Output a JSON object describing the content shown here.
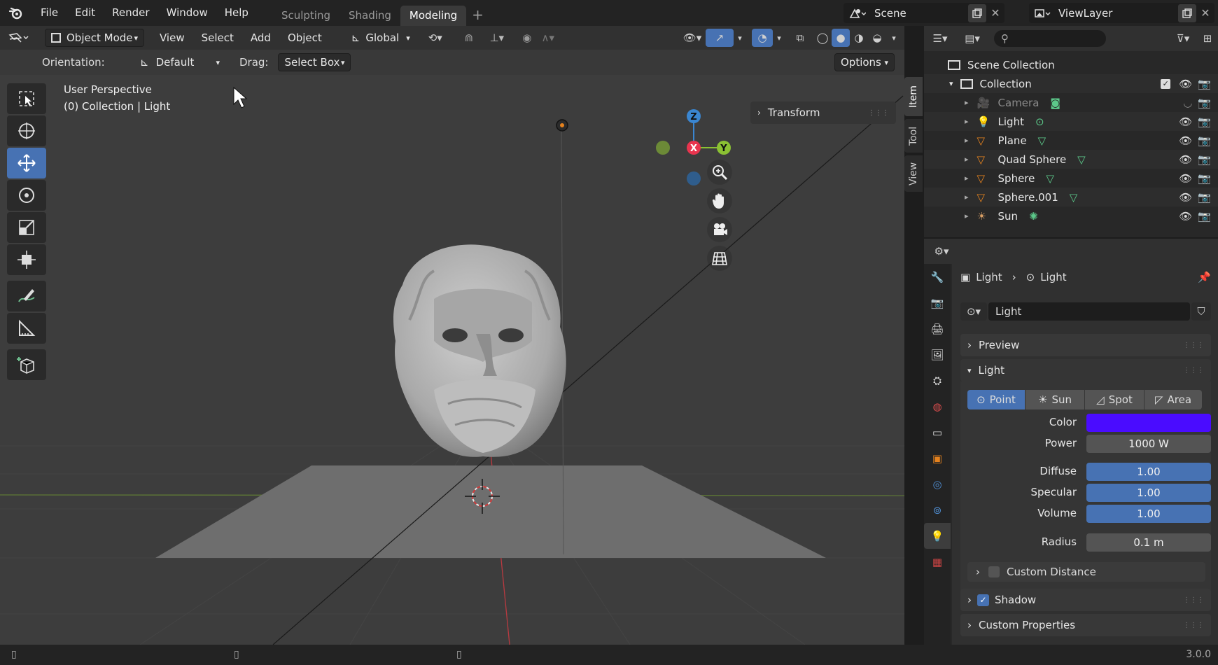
{
  "menu": [
    "File",
    "Edit",
    "Render",
    "Window",
    "Help"
  ],
  "workspaces": [
    {
      "label": "Sculpting",
      "active": false
    },
    {
      "label": "Shading",
      "active": false
    },
    {
      "label": "Modeling",
      "active": true
    }
  ],
  "scene": {
    "label": "Scene"
  },
  "view_layer": {
    "label": "ViewLayer"
  },
  "viewport": {
    "mode": "Object Mode",
    "menus": [
      "View",
      "Select",
      "Add",
      "Object"
    ],
    "transform_orientation": "Global",
    "orientation_label": "Orientation:",
    "orientation_value": "Default",
    "drag_label": "Drag:",
    "drag_value": "Select Box",
    "options_label": "Options",
    "overlay_line1": "User Perspective",
    "overlay_line2": "(0) Collection | Light",
    "transform_panel": "Transform",
    "sidebar_tabs": [
      "Item",
      "Tool",
      "View"
    ],
    "gizmo_axes": {
      "x": "X",
      "y": "Y",
      "z": "Z"
    },
    "axis_colors": {
      "x": "#e8344e",
      "y": "#8bc133",
      "z": "#3a86d1"
    }
  },
  "outliner": {
    "root": "Scene Collection",
    "collection": "Collection",
    "items": [
      {
        "name": "Camera",
        "type": "camera",
        "dimmed": true
      },
      {
        "name": "Light",
        "type": "light",
        "dimmed": false
      },
      {
        "name": "Plane",
        "type": "mesh",
        "dimmed": false
      },
      {
        "name": "Quad Sphere",
        "type": "mesh",
        "dimmed": false
      },
      {
        "name": "Sphere",
        "type": "mesh",
        "dimmed": false
      },
      {
        "name": "Sphere.001",
        "type": "mesh",
        "dimmed": false
      },
      {
        "name": "Sun",
        "type": "sun",
        "dimmed": false
      }
    ]
  },
  "properties": {
    "breadcrumb": [
      "Light",
      "Light"
    ],
    "datablock": "Light",
    "sections": {
      "preview": "Preview",
      "light": "Light",
      "custom_distance": "Custom Distance",
      "shadow": "Shadow",
      "custom_properties": "Custom Properties"
    },
    "light_types": [
      {
        "label": "Point",
        "active": true
      },
      {
        "label": "Sun",
        "active": false
      },
      {
        "label": "Spot",
        "active": false
      },
      {
        "label": "Area",
        "active": false
      }
    ],
    "fields": {
      "color_label": "Color",
      "color_value": "#4a0cff",
      "power_label": "Power",
      "power_value": "1000 W",
      "diffuse_label": "Diffuse",
      "diffuse_value": "1.00",
      "specular_label": "Specular",
      "specular_value": "1.00",
      "volume_label": "Volume",
      "volume_value": "1.00",
      "radius_label": "Radius",
      "radius_value": "0.1 m"
    },
    "shadow_checked": true,
    "custom_distance_checked": false
  },
  "status": {
    "version": "3.0.0"
  },
  "colors": {
    "accent": "#4772b3",
    "header": "#232323",
    "viewport_bg": "#3d3d3d"
  }
}
